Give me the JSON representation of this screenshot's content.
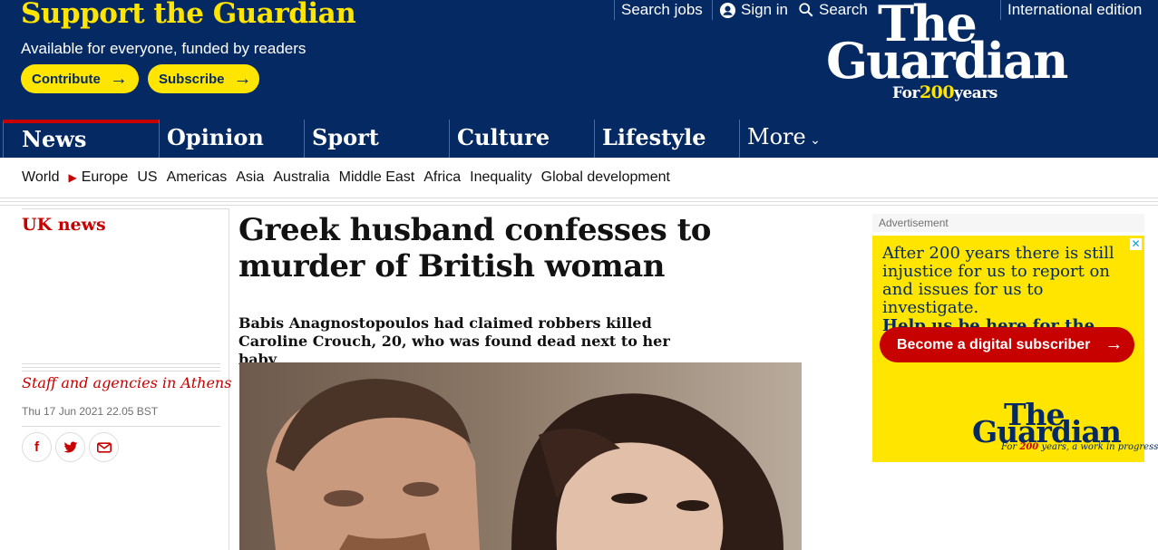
{
  "support": {
    "title": "Support the Guardian",
    "subtitle": "Available for everyone, funded by readers",
    "contribute": "Contribute",
    "subscribe": "Subscribe"
  },
  "topnav": {
    "search_jobs": "Search jobs",
    "sign_in": "Sign in",
    "search": "Search",
    "edition": "International edition"
  },
  "logo": {
    "line1": "The",
    "line2": "Guardian",
    "tag_for": "For",
    "tag_num": "200",
    "tag_years": "years"
  },
  "pillars": [
    "News",
    "Opinion",
    "Sport",
    "Culture",
    "Lifestyle"
  ],
  "pillar_more": "More",
  "subnav": {
    "items": [
      "World",
      "Europe",
      "US",
      "Americas",
      "Asia",
      "Australia",
      "Middle East",
      "Africa",
      "Inequality",
      "Global development"
    ]
  },
  "article": {
    "section": "UK news",
    "headline": "Greek husband confesses to murder of British woman",
    "standfirst": "Babis Anagnostopoulos had claimed robbers killed Caroline Crouch, 20, who was found dead next to her baby",
    "byline": "Staff and agencies in Athens",
    "date": "Thu 17 Jun 2021 22.05 BST"
  },
  "share": {
    "facebook": "f",
    "twitter": "t",
    "email": "email-icon"
  },
  "ad": {
    "label": "Advertisement",
    "text": "After 200 years there is still injustice for us to report on and issues for us to investigate.",
    "bold": "Help us be here for the long haul.",
    "button": "Become a digital subscriber",
    "logo1": "The",
    "logo2": "Guardian",
    "tag_for": "For ",
    "tag_num": "200",
    "tag_rest": "years, a work in progress"
  },
  "colors": {
    "brand": "#052962",
    "accent_yellow": "#ffe500",
    "news_red": "#c70000"
  }
}
